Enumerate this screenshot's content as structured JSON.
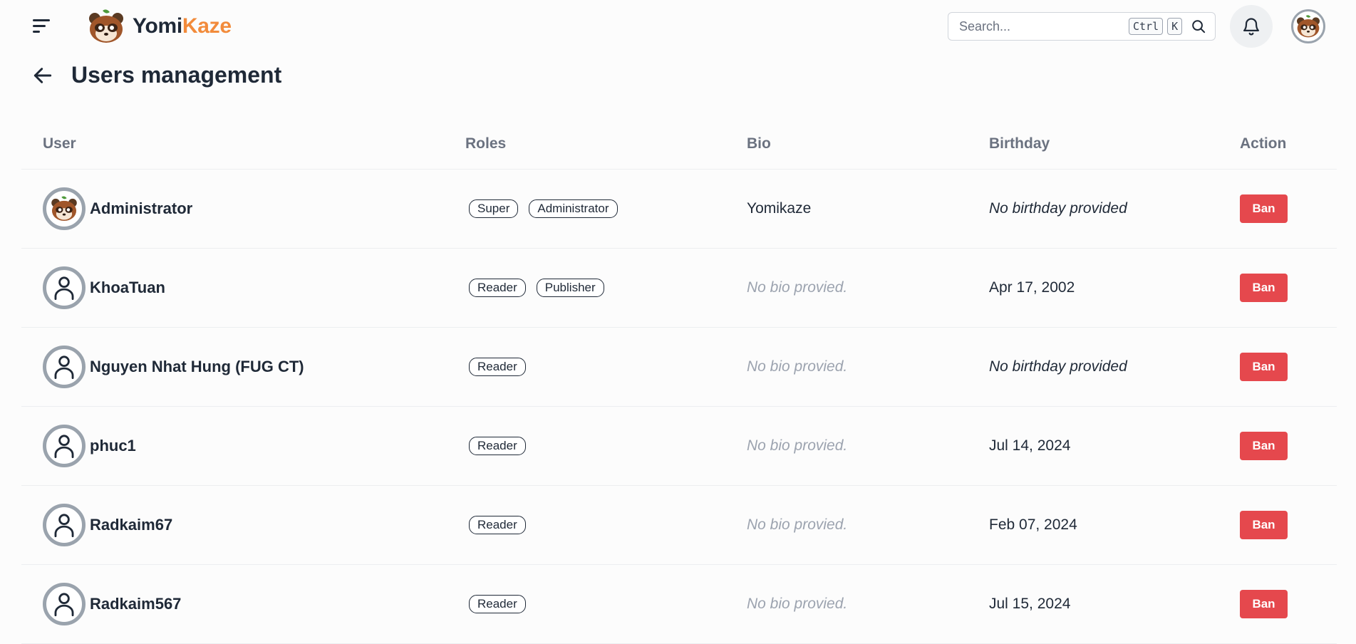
{
  "header": {
    "brand_part1": "Yomi",
    "brand_part2": "Kaze",
    "search_placeholder": "Search...",
    "search_shortcut_1": "Ctrl",
    "search_shortcut_2": "K"
  },
  "page": {
    "title": "Users management"
  },
  "table": {
    "columns": {
      "user": "User",
      "roles": "Roles",
      "bio": "Bio",
      "birthday": "Birthday",
      "action": "Action"
    },
    "rows": [
      {
        "name": "Administrator",
        "avatar": "mascot",
        "roles": [
          "Super",
          "Administrator"
        ],
        "bio": "Yomikaze",
        "bio_empty": false,
        "birthday": "No birthday provided",
        "birthday_empty": true,
        "action": "Ban"
      },
      {
        "name": "KhoaTuan",
        "avatar": "default",
        "roles": [
          "Reader",
          "Publisher"
        ],
        "bio": "No bio provied.",
        "bio_empty": true,
        "birthday": "Apr 17, 2002",
        "birthday_empty": false,
        "action": "Ban"
      },
      {
        "name": "Nguyen Nhat Hung (FUG CT)",
        "avatar": "default",
        "roles": [
          "Reader"
        ],
        "bio": "No bio provied.",
        "bio_empty": true,
        "birthday": "No birthday provided",
        "birthday_empty": true,
        "action": "Ban"
      },
      {
        "name": "phuc1",
        "avatar": "default",
        "roles": [
          "Reader"
        ],
        "bio": "No bio provied.",
        "bio_empty": true,
        "birthday": "Jul 14, 2024",
        "birthday_empty": false,
        "action": "Ban"
      },
      {
        "name": "Radkaim67",
        "avatar": "default",
        "roles": [
          "Reader"
        ],
        "bio": "No bio provied.",
        "bio_empty": true,
        "birthday": "Feb 07, 2024",
        "birthday_empty": false,
        "action": "Ban"
      },
      {
        "name": "Radkaim567",
        "avatar": "default",
        "roles": [
          "Reader"
        ],
        "bio": "No bio provied.",
        "bio_empty": true,
        "birthday": "Jul 15, 2024",
        "birthday_empty": false,
        "action": "Ban"
      }
    ]
  },
  "colors": {
    "accent": "#f28b3b",
    "danger": "#e5484d",
    "text": "#1f2937",
    "muted": "#9ca3af"
  },
  "icons": [
    "menu-icon",
    "bell-icon",
    "search-icon",
    "back-arrow-icon",
    "user-icon",
    "mascot-icon"
  ]
}
